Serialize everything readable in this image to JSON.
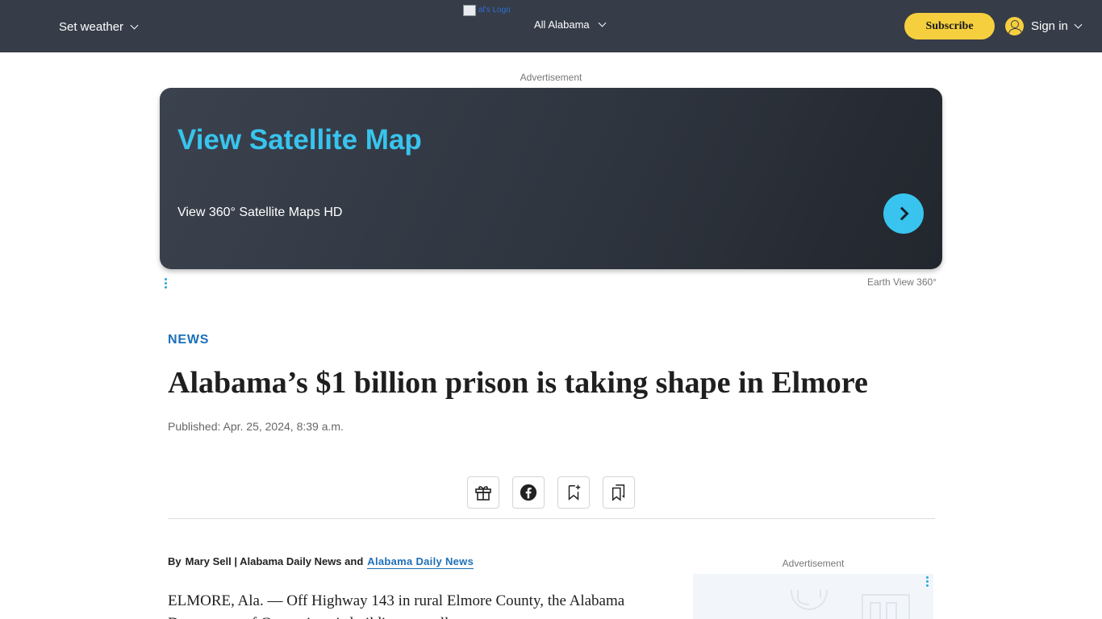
{
  "header": {
    "weather_label": "Set weather",
    "logo_alt": "al's Logo",
    "region_label": "All Alabama",
    "subscribe_label": "Subscribe",
    "signin_label": "Sign in"
  },
  "top_ad": {
    "label": "Advertisement",
    "title": "View Satellite Map",
    "subtitle": "View 360° Satellite Maps HD",
    "source": "Earth View 360°"
  },
  "article": {
    "section": "NEWS",
    "headline": "Alabama’s $1 billion prison is taking shape in Elmore",
    "published": "Published: Apr. 25, 2024, 8:39 a.m.",
    "byline_by": "By",
    "byline_authors": "Mary Sell | Alabama Daily News and",
    "byline_link": "Alabama Daily News",
    "body_first_line": "ELMORE, Ala. — Off Highway 143 in rural Elmore County, the Alabama",
    "body_second_line": "Department of Corrections is building a small town."
  },
  "share_tools": {
    "icons": [
      "gift-icon",
      "facebook-icon",
      "bookmark-add-icon",
      "saved-bookmarks-icon"
    ]
  },
  "side_ad": {
    "label": "Advertisement"
  },
  "colors": {
    "header_bg": "#363c48",
    "accent_yellow": "#f6cf3e",
    "link_blue": "#1d6fb8",
    "ad_cyan": "#38c4ee"
  }
}
